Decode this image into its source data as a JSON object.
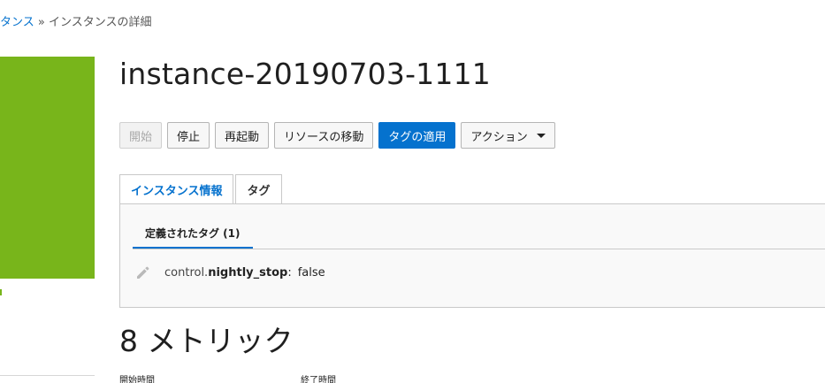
{
  "breadcrumb": {
    "parent": "タンス",
    "separator": "»",
    "current": "インスタンスの詳細"
  },
  "instance": {
    "title": "instance-20190703-1111",
    "status_color": "#78b51b"
  },
  "toolbar": {
    "start": "開始",
    "stop": "停止",
    "reboot": "再起動",
    "move_resource": "リソースの移動",
    "apply_tags": "タグの適用",
    "actions": "アクション"
  },
  "tabs": {
    "instance_info": "インスタンス情報",
    "tags": "タグ",
    "active": "tags"
  },
  "tags_panel": {
    "subtab": "定義されたタグ (1)",
    "tag": {
      "namespace": "control.",
      "key": "nightly_stop",
      "colon": ":",
      "value": "false"
    }
  },
  "metrics": {
    "heading": "8 メトリック",
    "start_time_label": "開始時間",
    "end_time_label": "終了時間"
  },
  "colors": {
    "accent": "#0572ce",
    "status_green": "#78b51b"
  }
}
